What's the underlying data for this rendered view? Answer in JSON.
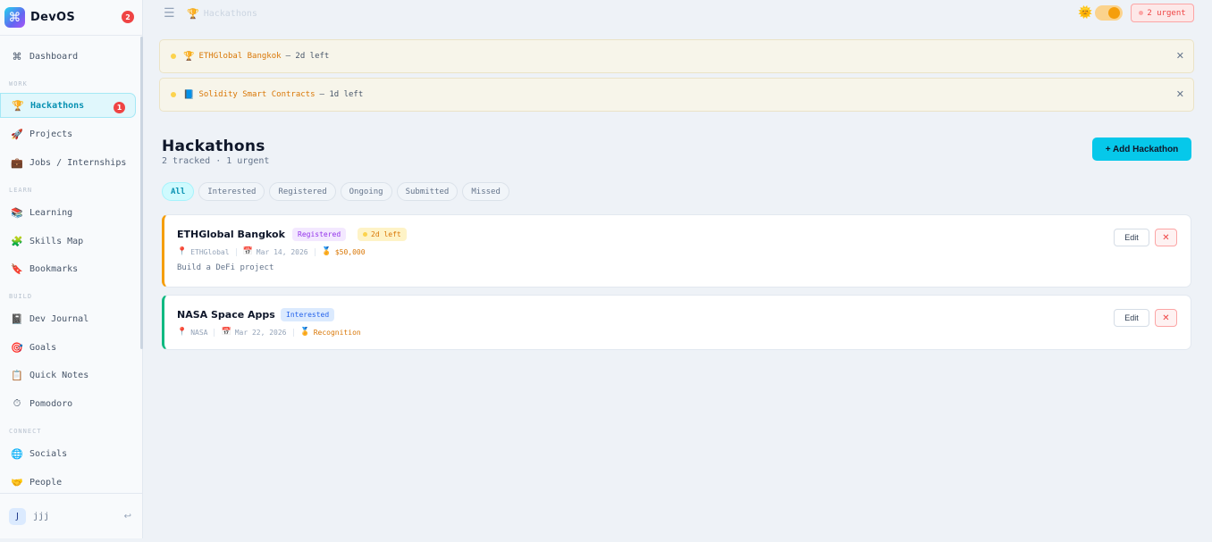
{
  "brand": {
    "logo_glyph": "⌘",
    "name": "DevOS",
    "badge_count": "2"
  },
  "sidebar": {
    "sections": {
      "work": "WORK",
      "learn": "LEARN",
      "build": "BUILD",
      "connect": "CONNECT"
    },
    "items": [
      {
        "label": "Dashboard",
        "icon": "⌘"
      },
      {
        "label": "Hackathons",
        "icon": "🏆",
        "badge": "1"
      },
      {
        "label": "Projects",
        "icon": "🚀"
      },
      {
        "label": "Jobs / Internships",
        "icon": "💼"
      },
      {
        "label": "Learning",
        "icon": "📚"
      },
      {
        "label": "Skills Map",
        "icon": "🧩"
      },
      {
        "label": "Bookmarks",
        "icon": "🔖"
      },
      {
        "label": "Dev Journal",
        "icon": "📓"
      },
      {
        "label": "Goals",
        "icon": "🎯"
      },
      {
        "label": "Quick Notes",
        "icon": "📋"
      },
      {
        "label": "Pomodoro",
        "icon": "⏱"
      },
      {
        "label": "Socials",
        "icon": "🌐"
      },
      {
        "label": "People",
        "icon": "🤝"
      }
    ],
    "user": {
      "initial": "J",
      "name": "jjj",
      "logout_icon": "↩"
    }
  },
  "topbar": {
    "menu_icon": "☰",
    "breadcrumb_icon": "🏆",
    "breadcrumb": "Hackathons",
    "theme_icon": "🌞",
    "urgent_label": "2 urgent"
  },
  "alerts": [
    {
      "icon": "🏆",
      "name": "ETHGlobal Bangkok",
      "suffix": "— 2d left",
      "close": "✕"
    },
    {
      "icon": "📘",
      "name": "Solidity Smart Contracts",
      "suffix": "— 1d left",
      "close": "✕"
    }
  ],
  "main": {
    "title": "Hackathons",
    "subtitle": "2 tracked · 1 urgent",
    "add_button": "+ Add Hackathon",
    "filters": [
      "All",
      "Interested",
      "Registered",
      "Ongoing",
      "Submitted",
      "Missed"
    ],
    "cards": [
      {
        "title": "ETHGlobal Bangkok",
        "status": "Registered",
        "days_left": "2d left",
        "organizer": "ETHGlobal",
        "date": "Mar 14, 2026",
        "prize": "$50,000",
        "description": "Build a DeFi project",
        "edit": "Edit",
        "delete": "✕"
      },
      {
        "title": "NASA Space Apps",
        "status": "Interested",
        "organizer": "NASA",
        "date": "Mar 22, 2026",
        "prize": "Recognition",
        "edit": "Edit",
        "delete": "✕"
      }
    ]
  },
  "icons": {
    "pin": "📍",
    "calendar": "📅",
    "medal": "🏅"
  },
  "colors": {
    "accent": "#06c8ea",
    "urgent": "#ef4444",
    "warning": "#f59e0b",
    "success": "#10b981"
  }
}
